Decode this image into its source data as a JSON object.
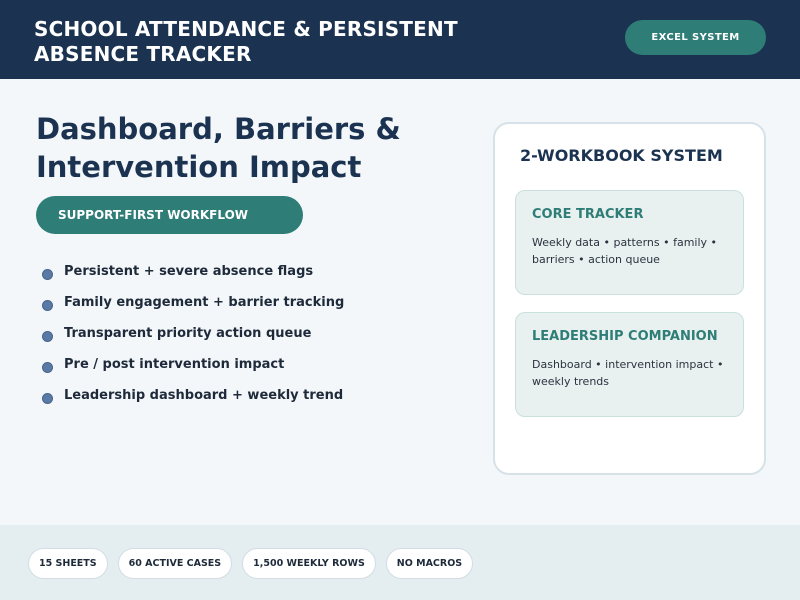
{
  "header": {
    "title": "SCHOOL ATTENDANCE & PERSISTENT ABSENCE TRACKER",
    "badge": "EXCEL SYSTEM"
  },
  "main": {
    "title": "Dashboard, Barriers & Intervention Impact",
    "workflow_label": "SUPPORT-FIRST WORKFLOW",
    "features": [
      "Persistent + severe absence flags",
      "Family engagement + barrier tracking",
      "Transparent priority action queue",
      "Pre / post intervention impact",
      "Leadership dashboard + weekly trend"
    ]
  },
  "card": {
    "title": "2-WORKBOOK SYSTEM",
    "workbooks": [
      {
        "title": "CORE TRACKER",
        "description": "Weekly data • patterns • family • barriers • action queue"
      },
      {
        "title": "LEADERSHIP COMPANION",
        "description": "Dashboard • intervention impact • weekly trends"
      }
    ]
  },
  "footer": {
    "stats": [
      "15 SHEETS",
      "60 ACTIVE CASES",
      "1,500 WEEKLY ROWS",
      "NO MACROS"
    ]
  },
  "colors": {
    "navy": "#1b3350",
    "teal": "#2e7d77",
    "bullet": "#5a7aa6",
    "background": "#f3f7fa"
  }
}
